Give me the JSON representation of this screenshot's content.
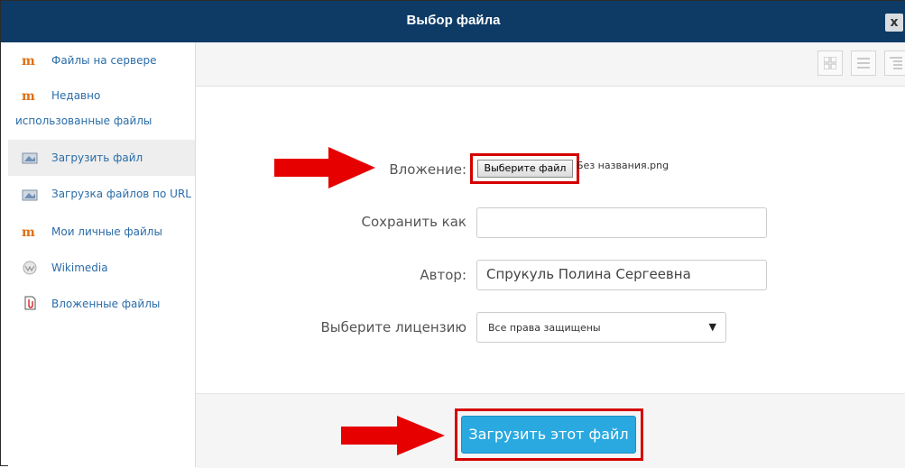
{
  "dialog": {
    "title": "Выбор файла",
    "close_glyph": "x"
  },
  "sidebar": {
    "items": [
      {
        "label": "Файлы на сервере",
        "icon": "moodle-icon"
      },
      {
        "label_line1": "Недавно",
        "label_line2": "использованные файлы",
        "icon": "moodle-icon"
      },
      {
        "label": "Загрузить файл",
        "icon": "upload-icon",
        "active": true
      },
      {
        "label": "Загрузка файлов по URL",
        "icon": "url-upload-icon"
      },
      {
        "label": "Мои личные файлы",
        "icon": "moodle-icon"
      },
      {
        "label": "Wikimedia",
        "icon": "wikimedia-icon"
      },
      {
        "label": "Вложенные файлы",
        "icon": "attached-files-icon"
      }
    ]
  },
  "toolbar": {
    "views": [
      {
        "icon": "icons-view-icon"
      },
      {
        "icon": "list-view-icon"
      },
      {
        "icon": "tree-view-icon"
      }
    ]
  },
  "form": {
    "attachment_label": "Вложение:",
    "choose_file_label": "Выберите файл",
    "chosen_file_name": "Без названия.png",
    "save_as_label": "Сохранить как",
    "save_as_value": "",
    "author_label": "Автор:",
    "author_value": "Спрукуль Полина Сергеевна",
    "license_label": "Выберите лицензию",
    "license_value": "Все права защищены",
    "upload_button_label": "Загрузить этот файл"
  },
  "colors": {
    "titlebar": "#0d3b66",
    "link": "#2a6ca8",
    "upload_button": "#2aa9e0",
    "highlight": "#d40000",
    "arrow": "#e60000"
  }
}
